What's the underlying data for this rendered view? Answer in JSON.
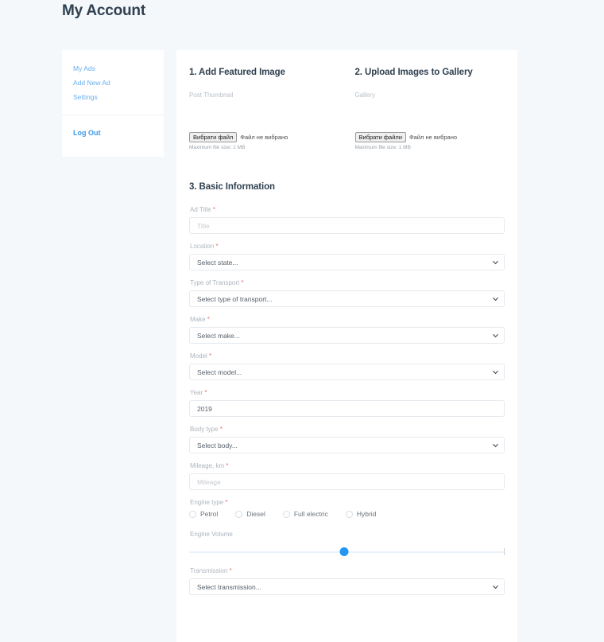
{
  "page": {
    "title": "My Account"
  },
  "sidebar": {
    "items": [
      {
        "label": "My Ads"
      },
      {
        "label": "Add New Ad"
      },
      {
        "label": "Settings"
      }
    ],
    "logout_label": "Log Out"
  },
  "upload": {
    "featured": {
      "heading": "1. Add Featured Image",
      "sublabel": "Post Thumbnail",
      "button_label": "Вибрати файл",
      "status": "Файл не вибрано",
      "hint": "Maximum file size: 1 MB"
    },
    "gallery": {
      "heading": "2. Upload Images to Gallery",
      "sublabel": "Gallery",
      "button_label": "Вибрати файли",
      "status": "Файл не вибрано",
      "hint": "Maximum file size: 1 MB"
    }
  },
  "basic": {
    "heading": "3. Basic Information",
    "required_mark": "*",
    "fields": {
      "ad_title": {
        "label": "Ad Title",
        "placeholder": "Title",
        "value": ""
      },
      "location": {
        "label": "Location",
        "selected": "Select state..."
      },
      "transport_type": {
        "label": "Type of Transport",
        "selected": "Select type of transport..."
      },
      "make": {
        "label": "Make",
        "selected": "Select make..."
      },
      "model": {
        "label": "Model",
        "selected": "Select model..."
      },
      "year": {
        "label": "Year",
        "value": "2019"
      },
      "body_type": {
        "label": "Body type",
        "selected": "Select body..."
      },
      "mileage": {
        "label": "Mileage, km",
        "placeholder": "Mileage",
        "value": ""
      },
      "engine_type": {
        "label": "Engine type",
        "options": [
          {
            "label": "Petrol",
            "selected": false
          },
          {
            "label": "Diesel",
            "selected": false
          },
          {
            "label": "Full electric",
            "selected": false
          },
          {
            "label": "Hybrid",
            "selected": false
          }
        ]
      },
      "engine_volume": {
        "label": "Engine Volume",
        "handle_percent": 49
      },
      "transmission": {
        "label": "Transmission",
        "selected": "Select transmission..."
      }
    }
  },
  "colors": {
    "page_bg": "#f4f8fb",
    "card_bg": "#ffffff",
    "heading": "#2f4050",
    "link": "#6aaef0",
    "logout": "#3c9ae8",
    "label": "#aeb5bc",
    "required": "#f26d6d",
    "border": "#e6eaee",
    "slider_handle": "#2196f3",
    "slider_track": "#eaf2fa"
  }
}
